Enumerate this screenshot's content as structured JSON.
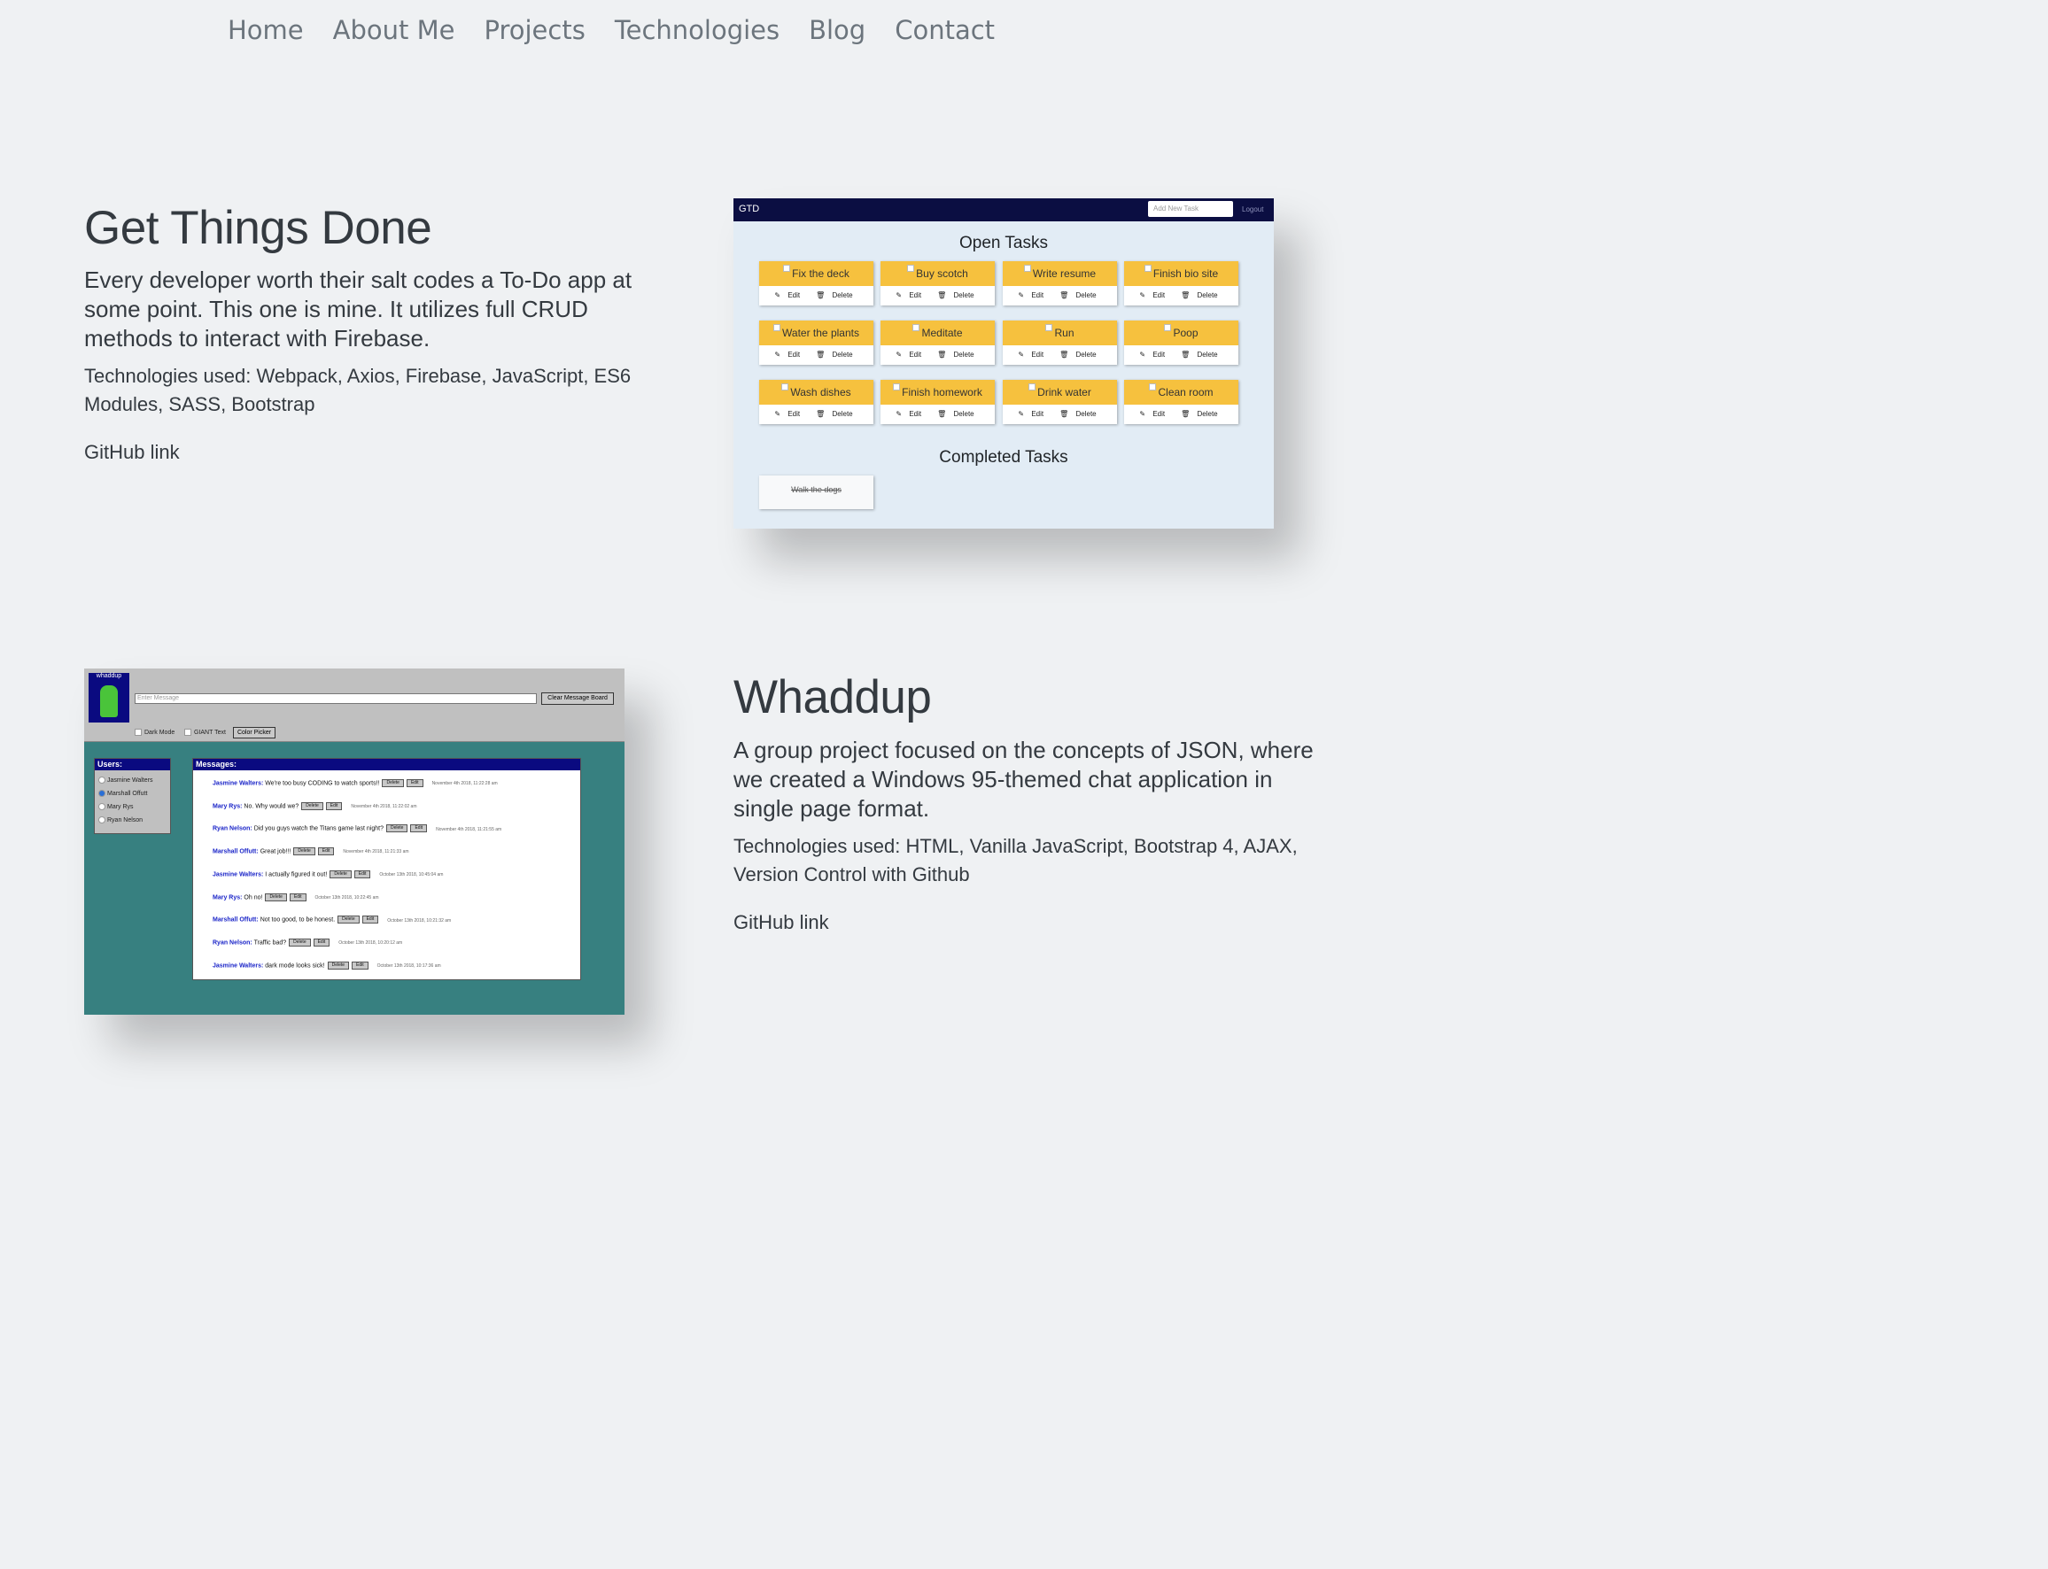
{
  "nav": {
    "items": [
      "Home",
      "About Me",
      "Projects",
      "Technologies",
      "Blog",
      "Contact"
    ]
  },
  "projects": [
    {
      "title": "Get Things Done",
      "lead": "Every developer worth their salt codes a To-Do app at some point. This one is mine. It utilizes full CRUD methods to interact with Firebase.",
      "tech": "Technologies used: Webpack, Axios, Firebase, JavaScript, ES6 Modules, SASS, Bootstrap",
      "link": "GitHub link"
    },
    {
      "title": "Whaddup",
      "lead": "A group project focused on the concepts of JSON, where we created a Windows 95-themed chat application in single page format.",
      "tech": "Technologies used: HTML, Vanilla JavaScript, Bootstrap 4, AJAX, Version Control with Github",
      "link": "GitHub link"
    }
  ],
  "gtd": {
    "brand": "GTD",
    "input_placeholder": "Add New Task",
    "logout": "Logout",
    "open_heading": "Open Tasks",
    "completed_heading": "Completed Tasks",
    "edit_label": "Edit",
    "delete_label": "Delete",
    "tasks": [
      "Fix the deck",
      "Buy scotch",
      "Write resume",
      "Finish bio site",
      "Water the plants",
      "Meditate",
      "Run",
      "Poop",
      "Wash dishes",
      "Finish homework",
      "Drink water",
      "Clean room"
    ],
    "completed": [
      "Walk the dogs"
    ],
    "colors": {
      "bar": "#0b0e42",
      "card": "#f6c13e",
      "bg": "#e2ecf5"
    }
  },
  "whaddup": {
    "logo_text": "whaddup",
    "input_placeholder": "Enter Message",
    "clear_button": "Clear Message Board",
    "dark_mode": "Dark Mode",
    "giant_text": "GIANT Text",
    "color_picker": "Color Picker",
    "users_heading": "Users:",
    "messages_heading": "Messages:",
    "users": [
      "Jasmine Walters",
      "Marshall Offutt",
      "Mary Rys",
      "Ryan Nelson"
    ],
    "selected_user": "Marshall Offutt",
    "delete_label": "Delete",
    "edit_label": "Edit",
    "messages": [
      {
        "user": "Jasmine Walters:",
        "text": "We're too busy CODING to watch sports!!",
        "time": "November 4th 2018, 11:22:28 am"
      },
      {
        "user": "Mary Rys:",
        "text": "No. Why would we?",
        "time": "November 4th 2018, 11:22:02 am"
      },
      {
        "user": "Ryan Nelson:",
        "text": "Did you guys watch the Titans game last night?",
        "time": "November 4th 2018, 11:21:55 am"
      },
      {
        "user": "Marshall Offutt:",
        "text": "Great job!!!",
        "time": "November 4th 2018, 11:21:33 am"
      },
      {
        "user": "Jasmine Walters:",
        "text": "I actually figured it out!",
        "time": "October 13th 2018, 10:45:04 am"
      },
      {
        "user": "Mary Rys:",
        "text": "Oh no!",
        "time": "October 13th 2018, 10:22:45 am"
      },
      {
        "user": "Marshall Offutt:",
        "text": "Not too good, to be honest.",
        "time": "October 13th 2018, 10:21:32 am"
      },
      {
        "user": "Ryan Nelson:",
        "text": "Traffic bad?",
        "time": "October 13th 2018, 10:20:12 am"
      },
      {
        "user": "Jasmine Walters:",
        "text": "dark mode looks sick!",
        "time": "October 13th 2018, 10:17:36 am"
      }
    ],
    "colors": {
      "bg": "#378080",
      "chrome": "#c0c0c0",
      "titlebar": "#0a0a80",
      "username": "#1a24c8"
    }
  }
}
